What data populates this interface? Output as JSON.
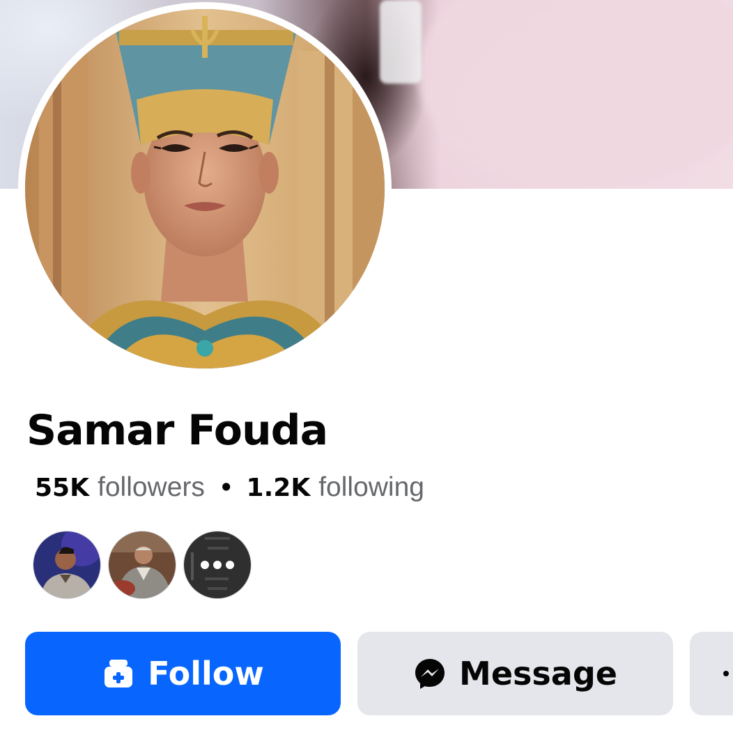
{
  "profile": {
    "name": "Samar Fouda",
    "followers_count": "55K",
    "followers_label": "followers",
    "separator": "•",
    "following_count": "1.2K",
    "following_label": "following"
  },
  "mutual_friends": [
    {
      "name": "mutual-friend-1"
    },
    {
      "name": "mutual-friend-2"
    },
    {
      "name": "mutual-friend-3"
    }
  ],
  "actions": {
    "follow_label": "Follow",
    "follow_icon": "follow-plus-icon",
    "message_label": "Message",
    "message_icon": "messenger-icon",
    "more_icon": "more-icon"
  },
  "colors": {
    "primary": "#0866ff",
    "secondary_button": "#e4e6eb",
    "text": "#050505",
    "muted_text": "#65676b"
  }
}
